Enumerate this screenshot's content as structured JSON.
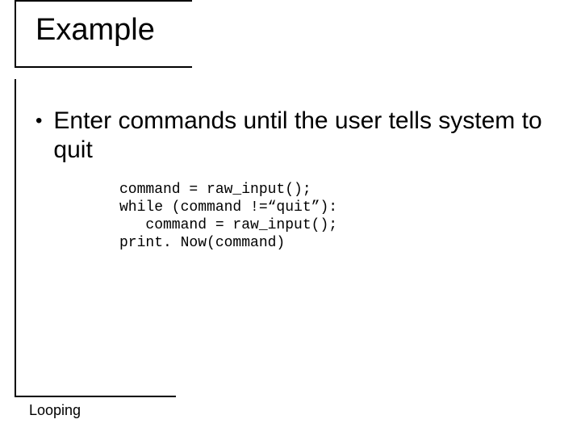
{
  "title": "Example",
  "bullet_text": "Enter commands until the user tells system to quit",
  "code": "command = raw_input();\nwhile (command !=“quit”):\n   command = raw_input();\nprint. Now(command)",
  "footer": "Looping"
}
